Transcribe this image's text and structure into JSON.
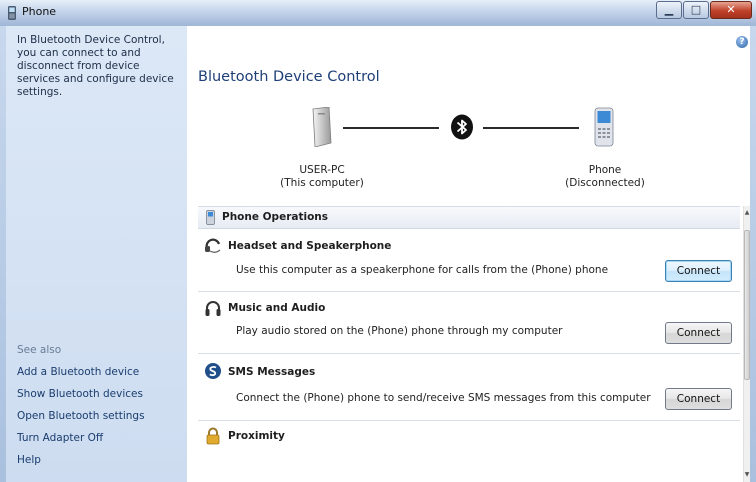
{
  "window": {
    "title": "Phone"
  },
  "left_panel": {
    "description": "In Bluetooth Device Control, you can connect to and disconnect from device services and configure device settings.",
    "see_also": "See also",
    "links": [
      "Add a Bluetooth device",
      "Show Bluetooth devices",
      "Open Bluetooth settings",
      "Turn Adapter Off",
      "Help"
    ]
  },
  "main": {
    "heading": "Bluetooth Device Control",
    "help_glyph": "?",
    "computer": {
      "name": "USER-PC",
      "sub": "(This computer)"
    },
    "device": {
      "name": "Phone",
      "sub": "(Disconnected)"
    },
    "operations_title": "Phone Operations",
    "services": [
      {
        "name": "Headset and Speakerphone",
        "desc": "Use this computer as a speakerphone for calls from the (Phone) phone",
        "button": "Connect"
      },
      {
        "name": "Music and Audio",
        "desc": "Play audio stored on the (Phone) phone through my computer",
        "button": "Connect"
      },
      {
        "name": "SMS Messages",
        "desc": "Connect the (Phone) phone to send/receive SMS messages from this computer",
        "button": "Connect"
      },
      {
        "name": "Proximity",
        "desc": "",
        "button": ""
      }
    ]
  },
  "colors": {
    "heading": "#1e3f78",
    "link": "#1a3d6e",
    "sidebar": "#d3e1f3",
    "close": "#c0412a"
  },
  "icons": {
    "window_buttons": [
      "minimize-icon",
      "maximize-icon",
      "close-icon"
    ],
    "service_icons": [
      "headset-icon",
      "headphones-icon",
      "sms-icon",
      "lock-icon"
    ]
  }
}
